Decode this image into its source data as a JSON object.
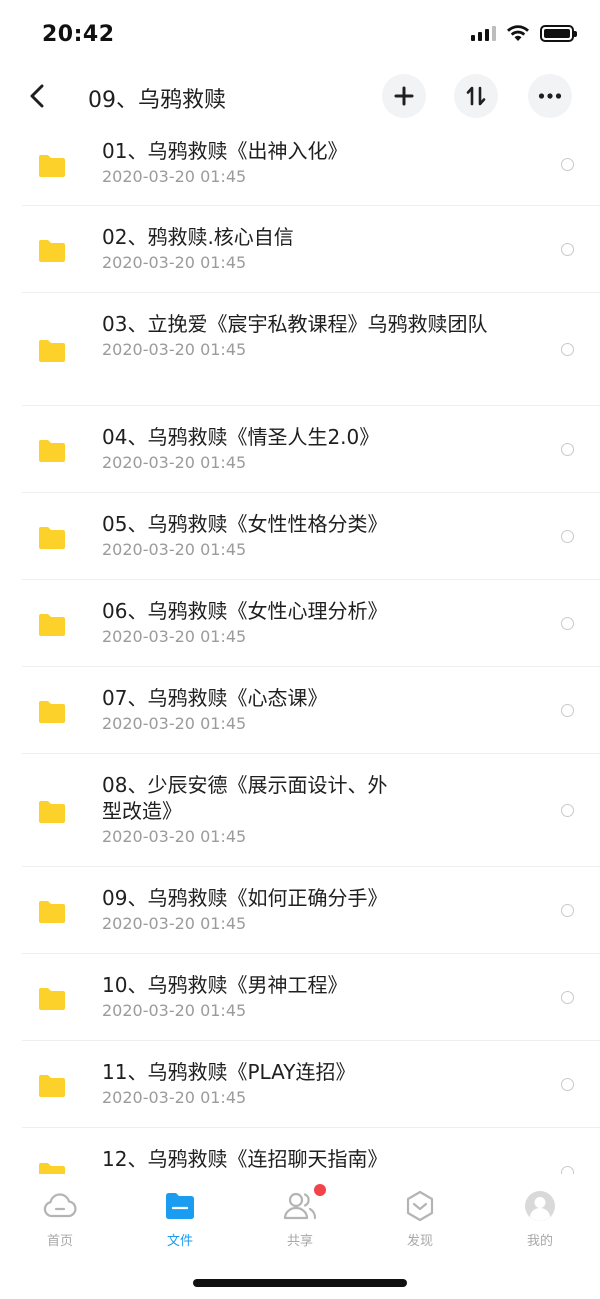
{
  "status_bar": {
    "time": "20:42"
  },
  "nav": {
    "title": "09、乌鸦救赎"
  },
  "files": [
    {
      "name": "01、乌鸦救赎《出神入化》",
      "date": "2020-03-20 01:45"
    },
    {
      "name": "02、鸦救赎.核心自信",
      "date": "2020-03-20 01:45"
    },
    {
      "name": "03、立挽爱《宸宇私教课程》乌鸦救赎团队",
      "date": "2020-03-20 01:45"
    },
    {
      "name": "04、乌鸦救赎《情圣人生2.0》",
      "date": "2020-03-20 01:45"
    },
    {
      "name": "05、乌鸦救赎《女性性格分类》",
      "date": "2020-03-20 01:45"
    },
    {
      "name": "06、乌鸦救赎《女性心理分析》",
      "date": "2020-03-20 01:45"
    },
    {
      "name": "07、乌鸦救赎《心态课》",
      "date": "2020-03-20 01:45"
    },
    {
      "name": "08、少辰安德《展示面设计、外型改造》",
      "date": "2020-03-20 01:45"
    },
    {
      "name": "09、乌鸦救赎《如何正确分手》",
      "date": "2020-03-20 01:45"
    },
    {
      "name": "10、乌鸦救赎《男神工程》",
      "date": "2020-03-20 01:45"
    },
    {
      "name": "11、乌鸦救赎《PLAY连招》",
      "date": "2020-03-20 01:45"
    },
    {
      "name": "12、乌鸦救赎《连招聊天指南》",
      "date": ""
    }
  ],
  "tabs": [
    {
      "label": "首页",
      "icon": "cloud-icon"
    },
    {
      "label": "文件",
      "icon": "folder-icon"
    },
    {
      "label": "共享",
      "icon": "share-users-icon"
    },
    {
      "label": "发现",
      "icon": "discover-icon"
    },
    {
      "label": "我的",
      "icon": "avatar-icon"
    }
  ],
  "colors": {
    "accent": "#1a9cf1",
    "folder": "#fcd12a",
    "badge": "#f2424a"
  }
}
